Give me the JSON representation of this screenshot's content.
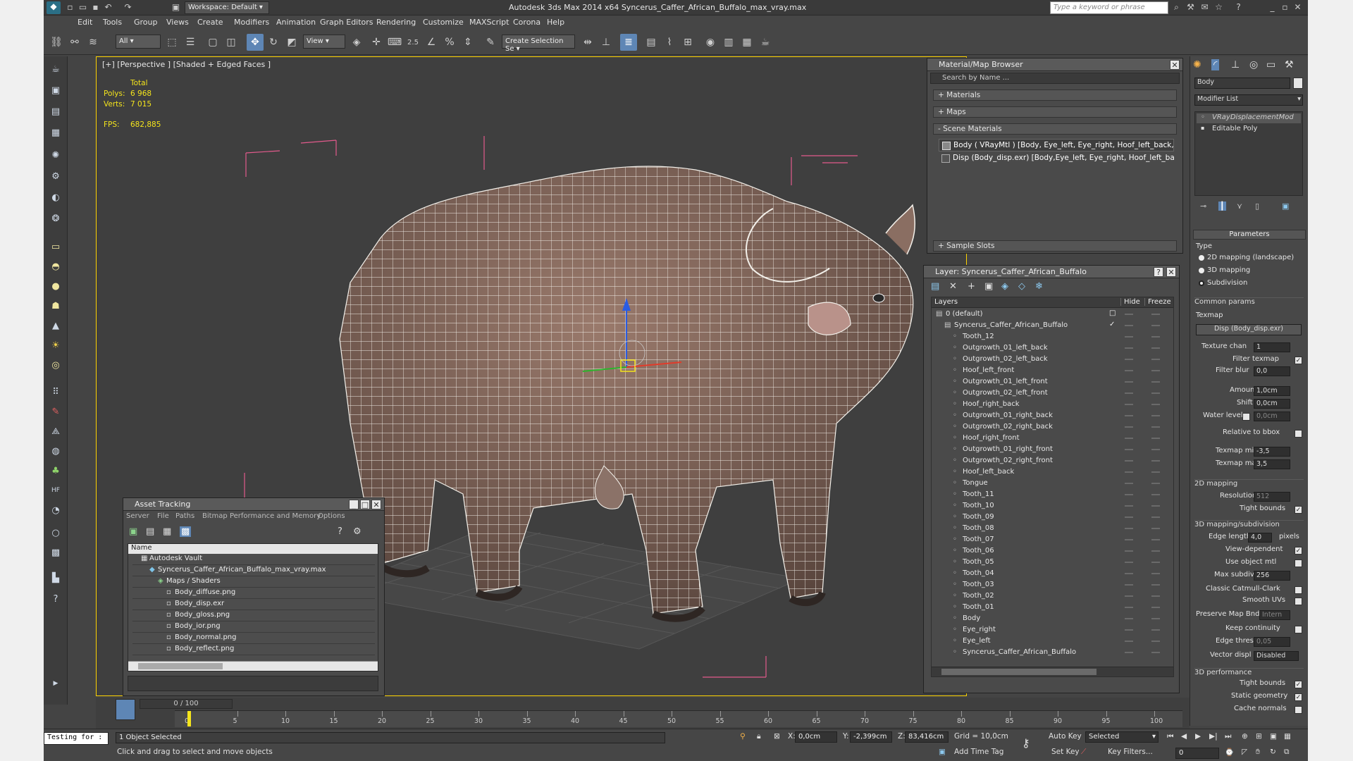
{
  "app": {
    "title": "Autodesk 3ds Max  2014 x64     Syncerus_Caffer_African_Buffalo_max_vray.max",
    "workspace": "Workspace: Default",
    "search_placeholder": "Type a keyword or phrase"
  },
  "menu": [
    "Edit",
    "Tools",
    "Group",
    "Views",
    "Create",
    "Modifiers",
    "Animation",
    "Graph Editors",
    "Rendering",
    "Customize",
    "MAXScript",
    "Corona",
    "Help"
  ],
  "toolbar": {
    "filter": "All",
    "refcoord": "View",
    "snap_label": "2.5",
    "selset": "Create Selection Se"
  },
  "viewport": {
    "label": "[+] [Perspective ] [Shaded + Edged Faces ]",
    "stats": {
      "total": "Total",
      "polys_label": "Polys:",
      "polys": "6 968",
      "verts_label": "Verts:",
      "verts": "7 015",
      "fps_label": "FPS:",
      "fps": "682,885"
    }
  },
  "material_browser": {
    "title": "Material/Map Browser",
    "search": "Search by Name ...",
    "rollouts": [
      "+ Materials",
      "+ Maps",
      "- Scene Materials",
      "+ Sample Slots"
    ],
    "scene_materials": [
      "Body ( VRayMtl ) [Body, Eye_left, Eye_right, Hoof_left_back,...",
      "Disp (Body_disp.exr) [Body,Eye_left, Eye_right, Hoof_left_bac..."
    ]
  },
  "layer_panel": {
    "title": "Layer: Syncerus_Caffer_African_Buffalo",
    "col_layers": "Layers",
    "col_hide": "Hide",
    "col_freeze": "Freeze",
    "rows": [
      {
        "name": "0 (default)",
        "indent": 0
      },
      {
        "name": "Syncerus_Caffer_African_Buffalo",
        "indent": 1
      },
      {
        "name": "Tooth_12",
        "indent": 2
      },
      {
        "name": "Outgrowth_01_left_back",
        "indent": 2
      },
      {
        "name": "Outgrowth_02_left_back",
        "indent": 2
      },
      {
        "name": "Hoof_left_front",
        "indent": 2
      },
      {
        "name": "Outgrowth_01_left_front",
        "indent": 2
      },
      {
        "name": "Outgrowth_02_left_front",
        "indent": 2
      },
      {
        "name": "Hoof_right_back",
        "indent": 2
      },
      {
        "name": "Outgrowth_01_right_back",
        "indent": 2
      },
      {
        "name": "Outgrowth_02_right_back",
        "indent": 2
      },
      {
        "name": "Hoof_right_front",
        "indent": 2
      },
      {
        "name": "Outgrowth_01_right_front",
        "indent": 2
      },
      {
        "name": "Outgrowth_02_right_front",
        "indent": 2
      },
      {
        "name": "Hoof_left_back",
        "indent": 2
      },
      {
        "name": "Tongue",
        "indent": 2
      },
      {
        "name": "Tooth_11",
        "indent": 2
      },
      {
        "name": "Tooth_10",
        "indent": 2
      },
      {
        "name": "Tooth_09",
        "indent": 2
      },
      {
        "name": "Tooth_08",
        "indent": 2
      },
      {
        "name": "Tooth_07",
        "indent": 2
      },
      {
        "name": "Tooth_06",
        "indent": 2
      },
      {
        "name": "Tooth_05",
        "indent": 2
      },
      {
        "name": "Tooth_04",
        "indent": 2
      },
      {
        "name": "Tooth_03",
        "indent": 2
      },
      {
        "name": "Tooth_02",
        "indent": 2
      },
      {
        "name": "Tooth_01",
        "indent": 2
      },
      {
        "name": "Body",
        "indent": 2
      },
      {
        "name": "Eye_right",
        "indent": 2
      },
      {
        "name": "Eye_left",
        "indent": 2
      },
      {
        "name": "Syncerus_Caffer_African_Buffalo",
        "indent": 2
      }
    ]
  },
  "asset_tracking": {
    "title": "Asset Tracking",
    "menu": [
      "Server",
      "File",
      "Paths",
      "Bitmap Performance and Memory",
      "Options"
    ],
    "col_name": "Name",
    "rows": [
      {
        "name": "Autodesk Vault",
        "indent": 1
      },
      {
        "name": "Syncerus_Caffer_African_Buffalo_max_vray.max",
        "indent": 2
      },
      {
        "name": "Maps / Shaders",
        "indent": 3
      },
      {
        "name": "Body_diffuse.png",
        "indent": 4
      },
      {
        "name": "Body_disp.exr",
        "indent": 4
      },
      {
        "name": "Body_gloss.png",
        "indent": 4
      },
      {
        "name": "Body_ior.png",
        "indent": 4
      },
      {
        "name": "Body_normal.png",
        "indent": 4
      },
      {
        "name": "Body_reflect.png",
        "indent": 4
      }
    ]
  },
  "command_panel": {
    "object_name": "Body",
    "modifier_list": "Modifier List",
    "stack": [
      "VRayDisplacementMod",
      "Editable Poly"
    ],
    "parameters": "Parameters",
    "type_label": "Type",
    "type_options": [
      "2D mapping (landscape)",
      "3D mapping",
      "Subdivision"
    ],
    "common_params": "Common params",
    "texmap_label": "Texmap",
    "texmap": "Disp (Body_disp.exr)",
    "texture_chan_label": "Texture chan",
    "texture_chan": "1",
    "filter_texmap": "Filter texmap",
    "filter_blur_label": "Filter blur",
    "filter_blur": "0,0",
    "amount_label": "Amount",
    "amount": "1,0cm",
    "shift_label": "Shift",
    "shift": "0,0cm",
    "water_label": "Water level",
    "water": "0,0cm",
    "relative_bbox": "Relative to bbox",
    "texmap_min_label": "Texmap min",
    "texmap_min": "-3,5",
    "texmap_max_label": "Texmap max",
    "texmap_max": "3,5",
    "mapping2d": "2D mapping",
    "resolution_label": "Resolution",
    "resolution": "512",
    "tight_bounds": "Tight bounds",
    "mapping3d": "3D mapping/subdivision",
    "edge_length_label": "Edge length",
    "edge_length": "4,0",
    "pixels": "pixels",
    "view_dependent": "View-dependent",
    "use_object_mtl": "Use object mtl",
    "max_subdivs_label": "Max subdivs",
    "max_subdivs": "256",
    "catmull": "Classic Catmull-Clark",
    "smooth_uvs": "Smooth UVs",
    "preserve_label": "Preserve Map Bnd",
    "preserve": "Intern",
    "keep_continuity": "Keep continuity",
    "edge_thresh_label": "Edge thresh",
    "edge_thresh": "0,05",
    "vector_displ_label": "Vector displ",
    "vector_displ": "Disabled",
    "perf": "3D performance",
    "tight_bounds2": "Tight bounds",
    "static_geometry": "Static geometry",
    "cache_normals": "Cache normals"
  },
  "timeline": {
    "frame": "0 / 100",
    "ticks": [
      "0",
      "5",
      "10",
      "15",
      "20",
      "25",
      "30",
      "35",
      "40",
      "45",
      "50",
      "55",
      "60",
      "65",
      "70",
      "75",
      "80",
      "85",
      "90",
      "95",
      "100"
    ]
  },
  "status": {
    "script_box": "Testing for :",
    "selected": "1 Object Selected",
    "prompt": "Click and drag to select and move objects",
    "x_label": "X:",
    "x": "0,0cm",
    "y_label": "Y:",
    "y": "-2,399cm",
    "z_label": "Z:",
    "z": "83,416cm",
    "grid": "Grid = 10,0cm",
    "add_time_tag": "Add Time Tag",
    "auto_key": "Auto Key",
    "set_key": "Set Key",
    "key_mode": "Selected",
    "key_filters": "Key Filters...",
    "frame_field": "0"
  },
  "colors": {
    "accent": "#5e86b5",
    "stats": "#f4e41c",
    "wire": "#ffffff",
    "bbox": "#e25a8c",
    "gizmo_x": "#e23b2a",
    "gizmo_y": "#2db52d",
    "gizmo_z": "#2a5ce2",
    "selection": "#ffd400"
  }
}
